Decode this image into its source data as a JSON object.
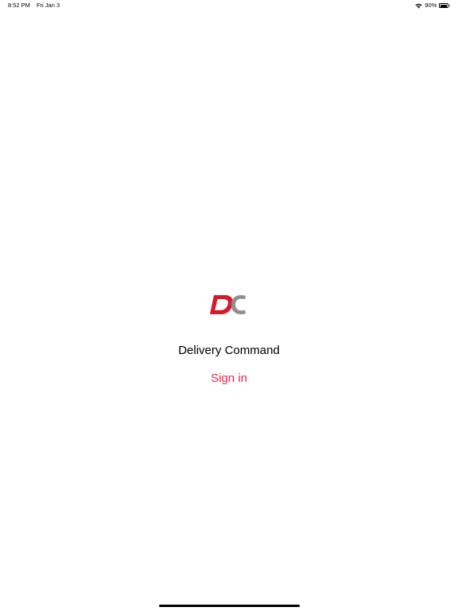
{
  "status_bar": {
    "time": "8:52 PM",
    "date": "Fri Jan 3",
    "battery_percent": "90%",
    "battery_level": 0.9,
    "wifi_icon": "wifi-icon",
    "battery_icon": "battery-icon"
  },
  "app": {
    "logo_text": "DC",
    "title": "Delivery Command",
    "sign_in_label": "Sign in"
  },
  "colors": {
    "accent": "#e8284f",
    "logo_red": "#d7192b",
    "logo_gray": "#8e8e8e"
  }
}
